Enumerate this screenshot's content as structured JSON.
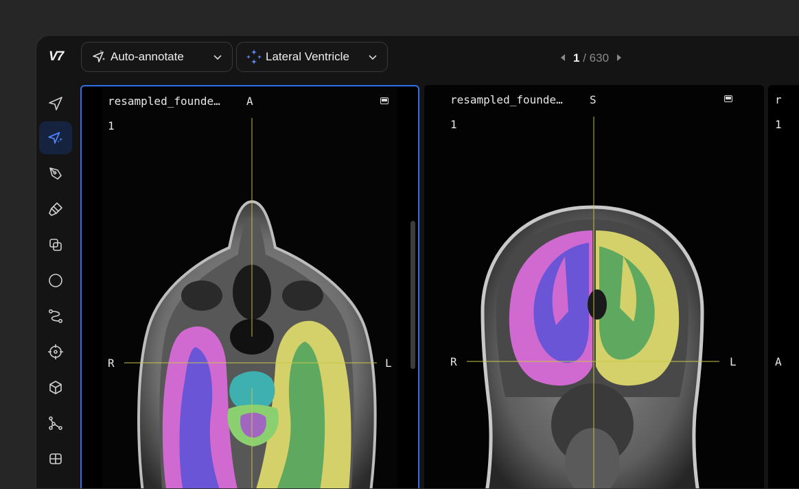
{
  "app": {
    "logo": "V7",
    "auto_annotate": {
      "label": "Auto-annotate"
    },
    "class_selector": {
      "label": "Lateral Ventricle"
    },
    "pager": {
      "current": "1",
      "separator": "/",
      "total": "630"
    }
  },
  "sidebar": {
    "tools": [
      {
        "name": "select-tool",
        "icon": "navigation-arrow-icon",
        "active": false
      },
      {
        "name": "auto-annotate-tool",
        "icon": "sparkle-arrow-icon",
        "active": true
      },
      {
        "name": "pen-tool",
        "icon": "pen-nib-icon",
        "active": false
      },
      {
        "name": "brush-tool",
        "icon": "brush-icon",
        "active": false
      },
      {
        "name": "clone-tool",
        "icon": "copy-icon",
        "active": false
      },
      {
        "name": "ellipse-tool",
        "icon": "circle-icon",
        "active": false
      },
      {
        "name": "polyline-tool",
        "icon": "path-icon",
        "active": false
      },
      {
        "name": "keypoint-tool",
        "icon": "crosshair-icon",
        "active": false
      },
      {
        "name": "cuboid-tool",
        "icon": "cube-icon",
        "active": false
      },
      {
        "name": "skeleton-tool",
        "icon": "skeleton-icon",
        "active": false
      },
      {
        "name": "table-tool",
        "icon": "table-icon",
        "active": false
      }
    ]
  },
  "viewports": [
    {
      "filename": "resampled_founde…",
      "top_label": "A",
      "left_label": "R",
      "right_label": "L",
      "slice": "1",
      "selected": true
    },
    {
      "filename": "resampled_founde…",
      "top_label": "S",
      "left_label": "R",
      "right_label": "L",
      "slice": "1",
      "selected": false
    },
    {
      "filename": "r",
      "left_label": "A",
      "slice": "1",
      "selected": false
    }
  ],
  "colors": {
    "accent": "#2f6fe8",
    "label_left_hemisphere": "#d06ad0",
    "label_left_hemisphere_inner": "#6a55d6",
    "label_right_hemisphere": "#d4d06a",
    "label_right_hemisphere_inner": "#5fa860",
    "label_brainstem": "#3fb0b0",
    "crosshair": "#c8c84a"
  }
}
